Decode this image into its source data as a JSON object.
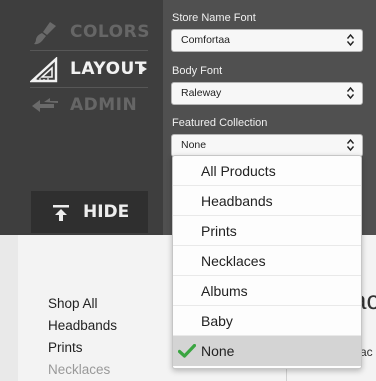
{
  "nav": {
    "items": [
      {
        "label": "COLORS",
        "icon": "brush-icon"
      },
      {
        "label": "LAYOUT",
        "icon": "triangle-ruler-icon"
      },
      {
        "label": "ADMIN",
        "icon": "back-arrows-icon"
      }
    ],
    "hide_label": "HIDE"
  },
  "settings": {
    "store_name_font": {
      "label": "Store Name Font",
      "value": "Comfortaa"
    },
    "body_font": {
      "label": "Body Font",
      "value": "Raleway"
    },
    "featured_collection": {
      "label": "Featured Collection",
      "value": "None"
    }
  },
  "dropdown": {
    "options": [
      "All Products",
      "Headbands",
      "Prints",
      "Necklaces",
      "Albums",
      "Baby",
      "None"
    ],
    "selected": "None"
  },
  "preview": {
    "links": [
      "Shop All",
      "Headbands",
      "Prints",
      "Necklaces"
    ]
  },
  "colors": {
    "editor_bg": "#505050",
    "nav_bg": "#3e3e3e",
    "check_green": "#3aa541",
    "selected_option_bg": "#d4d4d4"
  }
}
